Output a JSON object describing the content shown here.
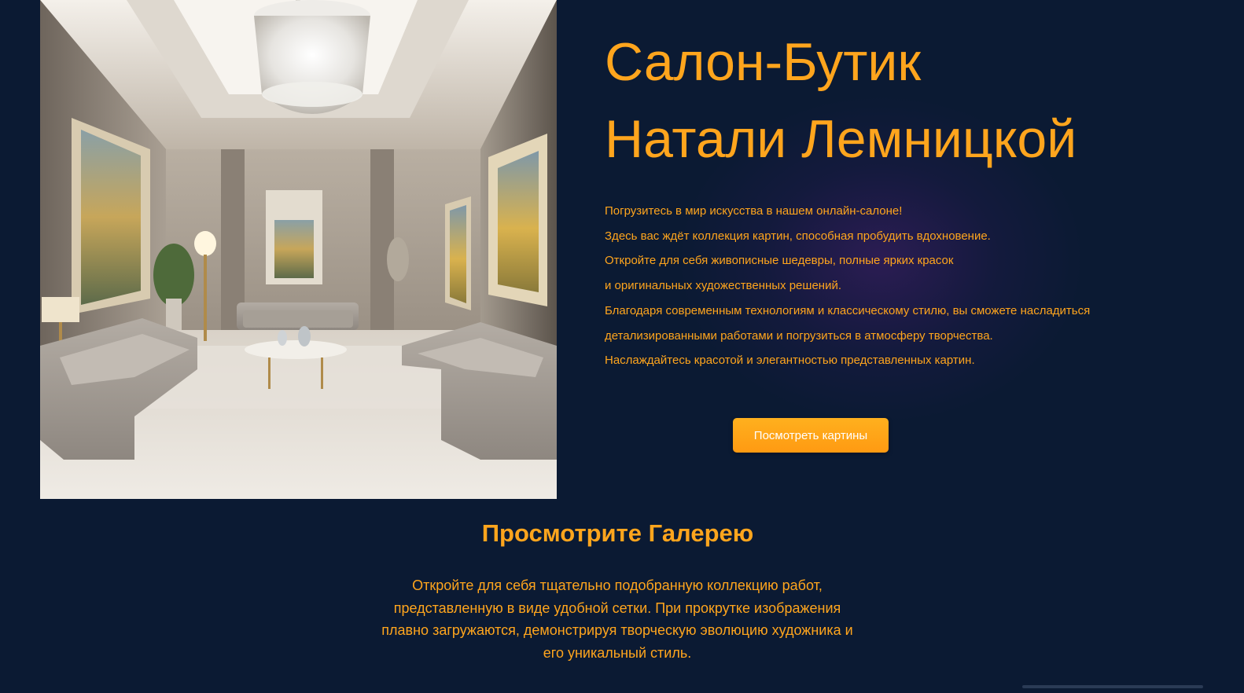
{
  "hero": {
    "title_lines": [
      "Салон-Бутик",
      "Натали Лемницкой"
    ],
    "paragraph_lines": [
      "Погрузитесь в мир искусства в нашем онлайн-салоне!",
      "Здесь вас ждёт коллекция картин, способная пробудить вдохновение.",
      "Откройте для себя живописные шедевры, полные ярких красок",
      "и оригинальных художественных решений.",
      "Благодаря современным технологиям и классическому стилю, вы сможете насладиться",
      "детализированными работами и погрузиться в атмосферу творчества.",
      "Наслаждайтесь красотой и элегантностью представленных картин."
    ],
    "cta_label": "Посмотреть картины"
  },
  "gallery": {
    "title": "Просмотрите Галерею",
    "text_lines": [
      "Откройте для себя тщательно подобранную коллекцию работ,",
      "представленную в виде удобной сетки. При прокрутке изображения",
      "плавно загружаются, демонстрируя творческую эволюцию художника и",
      "его уникальный стиль."
    ]
  },
  "colors": {
    "background": "#0b1a33",
    "accent": "#ffa51d",
    "button_text": "#ffffff"
  },
  "icons": {
    "hero_image": "luxury-gallery-lounge-image"
  }
}
